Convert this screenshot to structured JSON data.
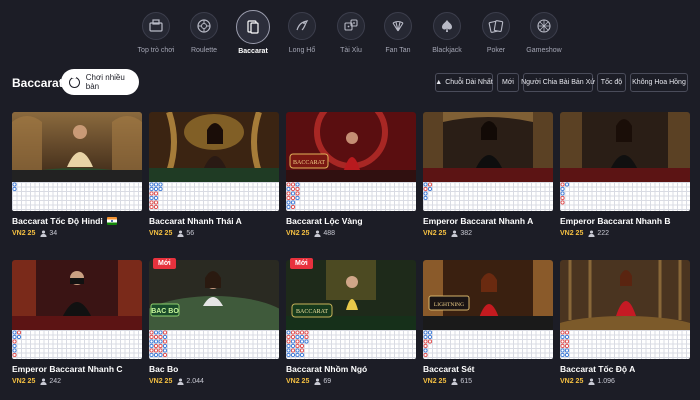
{
  "nav": {
    "categories": [
      {
        "label": "Top trò chơi",
        "icon": "top-games-icon",
        "active": false
      },
      {
        "label": "Roulette",
        "icon": "roulette-icon",
        "active": false
      },
      {
        "label": "Baccarat",
        "icon": "baccarat-icon",
        "active": true
      },
      {
        "label": "Long Hổ",
        "icon": "dragon-tiger-icon",
        "active": false
      },
      {
        "label": "Tài Xỉu",
        "icon": "dice-icon",
        "active": false
      },
      {
        "label": "Fan Tan",
        "icon": "fan-tan-icon",
        "active": false
      },
      {
        "label": "Blackjack",
        "icon": "blackjack-icon",
        "active": false
      },
      {
        "label": "Poker",
        "icon": "poker-icon",
        "active": false
      },
      {
        "label": "Gameshow",
        "icon": "gameshow-icon",
        "active": false
      }
    ]
  },
  "header": {
    "title": "Baccarat",
    "multi_table_label": "Chơi nhiều bàn"
  },
  "filters": [
    {
      "label": "Chuỗi Dài Nhất",
      "icon": "fire-icon"
    },
    {
      "label": "Mới"
    },
    {
      "label": "Người Chia Bài Bản Xứ"
    },
    {
      "label": "Tốc độ"
    },
    {
      "label": "Không Hoa Hồng"
    }
  ],
  "tables": [
    {
      "name": "Baccarat Tốc Độ Hindi",
      "limit": "VN2 25",
      "players": "34",
      "flag": "india-flag-icon",
      "is_new": false
    },
    {
      "name": "Baccarat Nhanh Thái A",
      "limit": "VN2 25",
      "players": "56",
      "is_new": false
    },
    {
      "name": "Baccarat Lộc Vàng",
      "limit": "VN2 25",
      "players": "488",
      "logo": "BACCARAT",
      "is_new": false
    },
    {
      "name": "Emperor Baccarat Nhanh A",
      "limit": "VN2 25",
      "players": "382",
      "is_new": false
    },
    {
      "name": "Emperor Baccarat Nhanh B",
      "limit": "VN2 25",
      "players": "222",
      "is_new": false
    },
    {
      "name": "Emperor Baccarat Nhanh C",
      "limit": "VN2 25",
      "players": "242",
      "is_new": false
    },
    {
      "name": "Bac Bo",
      "limit": "VN2 25",
      "players": "2.044",
      "logo": "BAC BO",
      "is_new": true,
      "badge": "Mới"
    },
    {
      "name": "Baccarat Nhồm Ngó",
      "limit": "VN2 25",
      "players": "69",
      "logo": "BACCARAT",
      "is_new": true,
      "badge": "Mới"
    },
    {
      "name": "Baccarat Sét",
      "limit": "VN2 25",
      "players": "615",
      "logo": "LIGHTNING",
      "is_new": false
    },
    {
      "name": "Baccarat Tốc Độ A",
      "limit": "VN2 25",
      "players": "1.096",
      "is_new": false
    }
  ],
  "colors": {
    "background": "#1c1d26",
    "limit": "#f5c042",
    "new_badge": "#e7323d",
    "banker": "#e03a3a",
    "player": "#2b6fd6"
  }
}
